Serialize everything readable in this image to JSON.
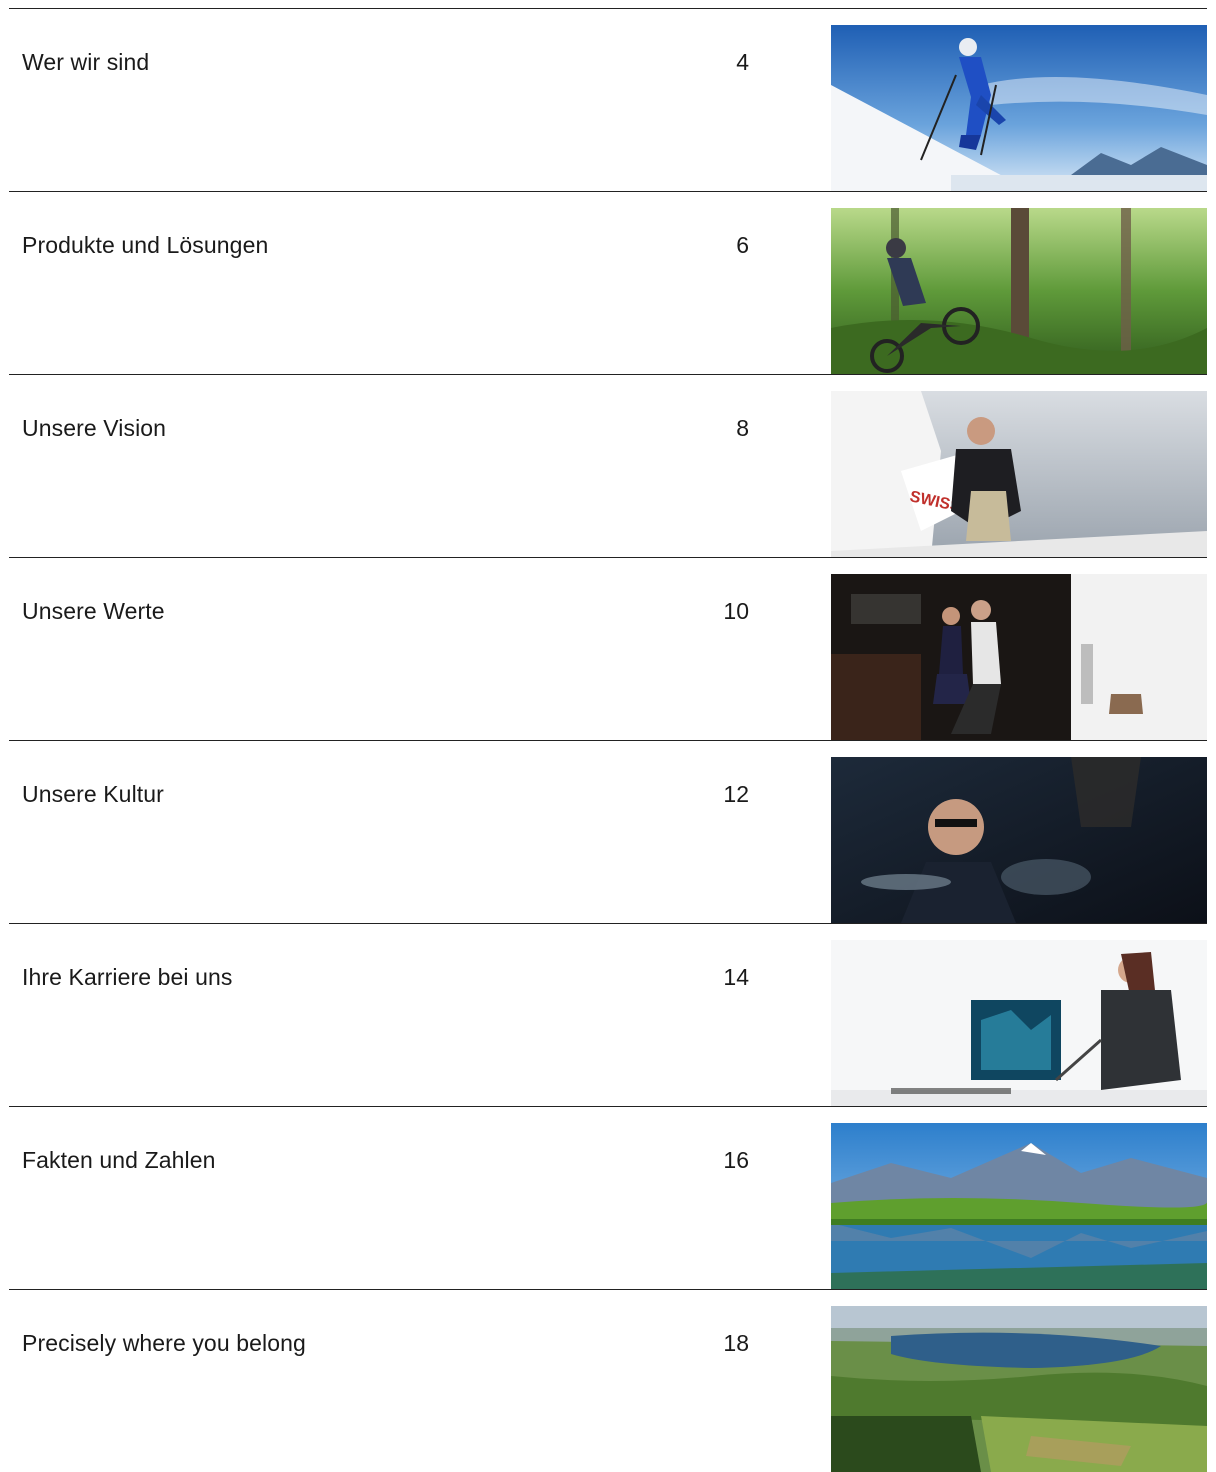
{
  "toc": {
    "entries": [
      {
        "title": "Wer wir sind",
        "page": "4",
        "image": "skier-on-slope-image"
      },
      {
        "title": "Produkte und Lösungen",
        "page": "6",
        "image": "mountain-biker-forest-image"
      },
      {
        "title": "Unsere Vision",
        "page": "8",
        "image": "man-beside-aircraft-image"
      },
      {
        "title": "Unsere Werte",
        "page": "10",
        "image": "dancing-couple-image"
      },
      {
        "title": "Unsere Kultur",
        "page": "12",
        "image": "drummer-image"
      },
      {
        "title": "Ihre Karriere bei uns",
        "page": "14",
        "image": "woman-painting-image"
      },
      {
        "title": "Fakten und Zahlen",
        "page": "16",
        "image": "alpine-lake-image"
      },
      {
        "title": "Precisely where you belong",
        "page": "18",
        "image": "aerial-landscape-image"
      }
    ]
  }
}
